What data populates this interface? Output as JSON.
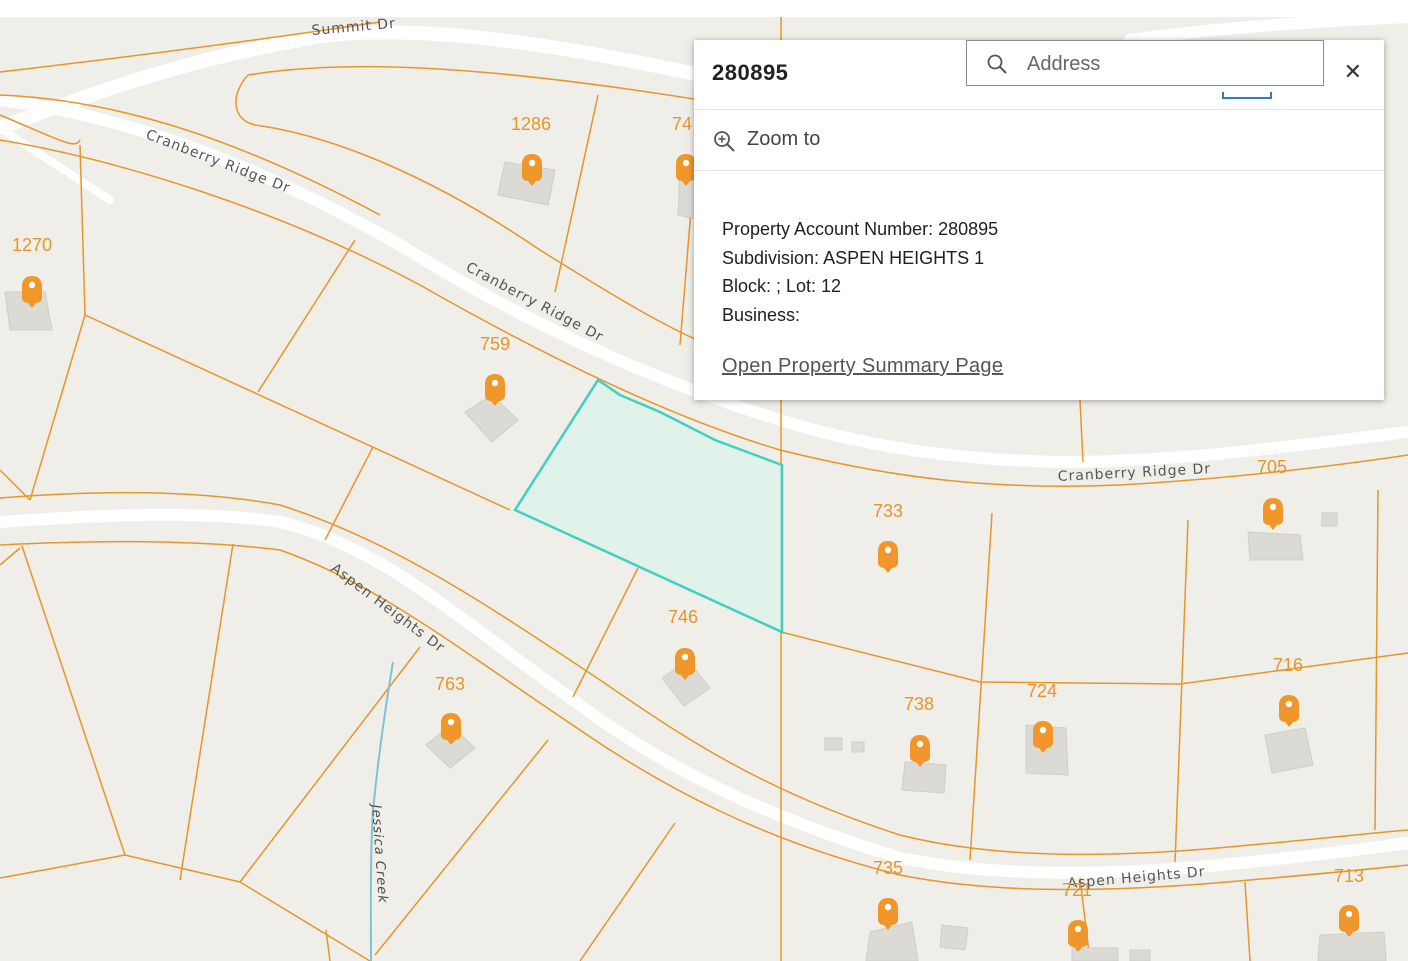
{
  "map": {
    "streets": {
      "summit": "Summit Dr",
      "cranberry_1": "Cranberry Ridge Dr",
      "cranberry_2": "Cranberry Ridge Dr",
      "cranberry_3": "Cranberry Ridge Dr",
      "aspen_1": "Aspen Heights Dr",
      "aspen_2": "Aspen Heights Dr"
    },
    "creek": "Jessica Creek",
    "addresses": {
      "a1286": "1286",
      "a74": "74",
      "a1270": "1270",
      "a759": "759",
      "a705": "705",
      "a733": "733",
      "a746": "746",
      "a763": "763",
      "a738": "738",
      "a724": "724",
      "a716": "716",
      "a735": "735",
      "a721": "721",
      "a713": "713"
    },
    "colors": {
      "parcel_line": "#e8952a",
      "marker": "#f0962a",
      "selection": "#3fd1c0",
      "road": "#ffffff",
      "land": "#efeee8",
      "creek": "#7fc3d6"
    }
  },
  "popup": {
    "title": "280895",
    "zoom_label": "Zoom to",
    "close_icon": "close-icon",
    "fields": {
      "account": "Property Account Number: 280895",
      "subdivision": "Subdivision: ASPEN HEIGHTS 1",
      "block_lot": "Block: ;  Lot:  12",
      "business": "Business:"
    },
    "link": "Open Property Summary Page"
  },
  "search": {
    "placeholder": "Address",
    "icon": "search-icon"
  }
}
